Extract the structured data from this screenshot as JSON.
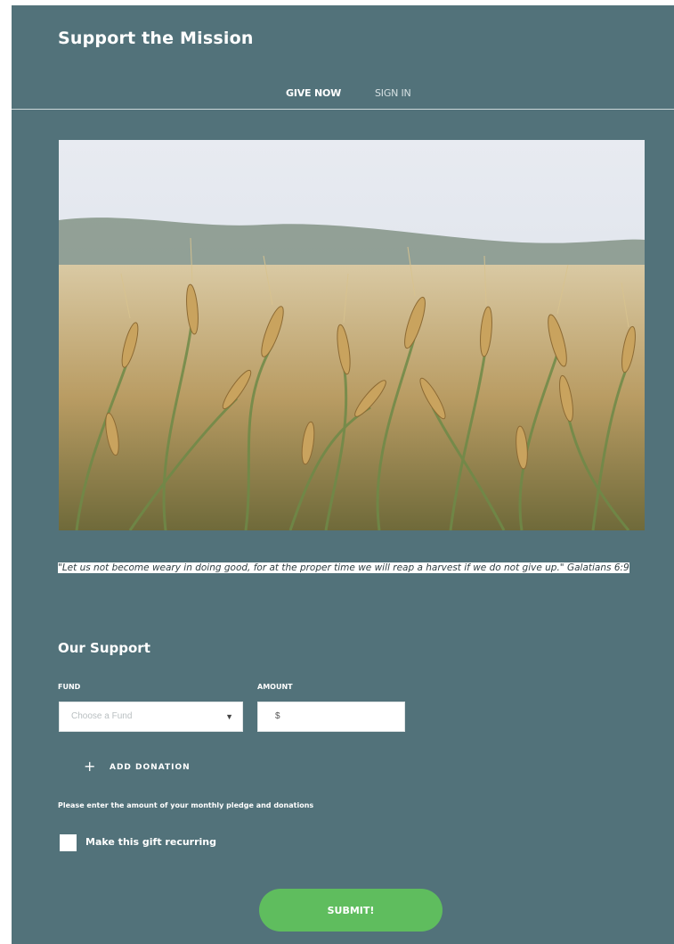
{
  "header": {
    "title": "Support the Mission",
    "nav": [
      {
        "label": "GIVE NOW",
        "active": true
      },
      {
        "label": "SIGN IN",
        "active": false
      }
    ]
  },
  "quote": {
    "text": "\"Let us not become weary in doing good, for at the proper time we will reap a harvest if we do not give up.\"  Galatians 6:9"
  },
  "form": {
    "section_title": "Our Support",
    "fund_label": "FUND",
    "fund_placeholder": "Choose a Fund",
    "amount_label": "AMOUNT",
    "amount_currency": "$",
    "add_donation_label": "ADD DONATION",
    "help_text": "Please enter the amount of your monthly pledge and donations",
    "recurring_label": "Make this gift recurring",
    "submit_label": "SUBMIT!"
  },
  "colors": {
    "background": "#52727a",
    "submit": "#5fbd5e"
  }
}
